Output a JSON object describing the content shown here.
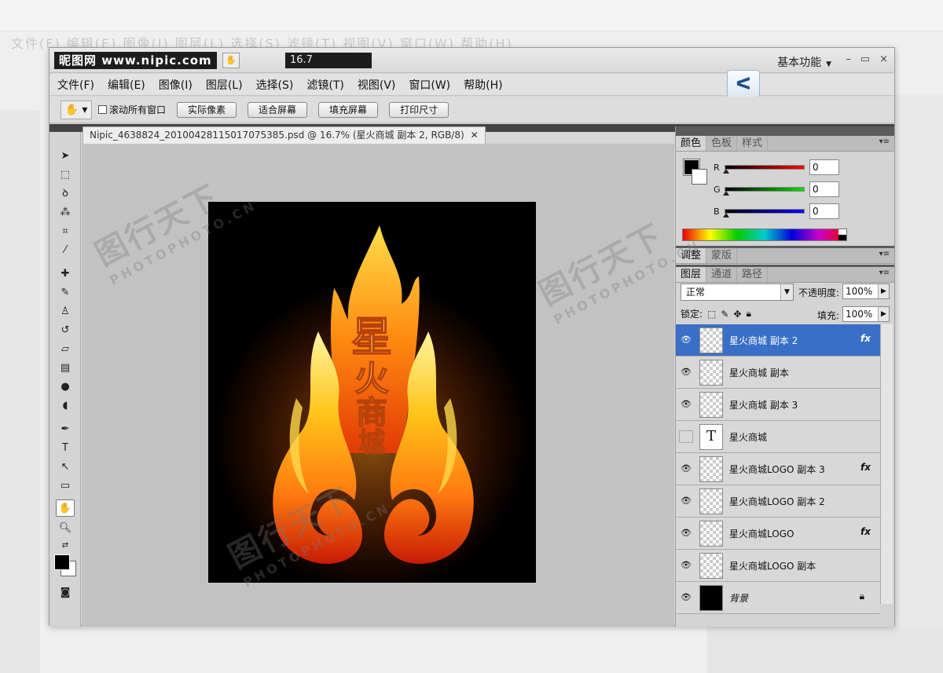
{
  "ghost_background": {
    "menu_text": "文件(F)  编辑(E)  图像(I)  图层(L)  选择(S)  滤镜(T)  视图(V)  窗口(W)  帮助(H)",
    "workspace_label": "基本功能"
  },
  "window": {
    "logo_text": "昵图网 www.nipic.com",
    "zoom_display": "16.7",
    "workspace_label": "基本功能",
    "controls": [
      "–",
      "▭",
      "×"
    ]
  },
  "menu": [
    "文件(F)",
    "编辑(E)",
    "图像(I)",
    "图层(L)",
    "选择(S)",
    "滤镜(T)",
    "视图(V)",
    "窗口(W)",
    "帮助(H)"
  ],
  "options_bar": {
    "scroll_all_label": "滚动所有窗口",
    "buttons": [
      "实际像素",
      "适合屏幕",
      "填充屏幕",
      "打印尺寸"
    ]
  },
  "document": {
    "tab_title": "Nipic_4638824_20100428115017075385.psd @ 16.7% (星火商城 副本 2, RGB/8)",
    "artwork_text": "星火商城"
  },
  "color_panel": {
    "tabs": [
      "颜色",
      "色板",
      "样式"
    ],
    "r_label": "R",
    "g_label": "G",
    "b_label": "B",
    "r_value": "0",
    "g_value": "0",
    "b_value": "0",
    "fg_color": "#000000",
    "bg_color": "#ffffff"
  },
  "adjust_panel": {
    "tabs": [
      "调整",
      "蒙版"
    ]
  },
  "layers_panel": {
    "tabs": [
      "图层",
      "通道",
      "路径"
    ],
    "blend_mode": "正常",
    "opacity_label": "不透明度:",
    "opacity_value": "100%",
    "lock_label": "锁定:",
    "fill_label": "填充:",
    "fill_value": "100%",
    "layers": [
      {
        "name": "星火商城 副本 2",
        "visible": true,
        "fx": true,
        "selected": true
      },
      {
        "name": "星火商城 副本",
        "visible": true,
        "fx": false
      },
      {
        "name": "星火商城 副本 3",
        "visible": true,
        "fx": false
      },
      {
        "name": "星火商城",
        "visible": false,
        "fx": false,
        "type": "text"
      },
      {
        "name": "星火商城LOGO 副本 3",
        "visible": true,
        "fx": true
      },
      {
        "name": "星火商城LOGO 副本 2",
        "visible": true,
        "fx": false
      },
      {
        "name": "星火商城LOGO",
        "visible": true,
        "fx": true
      },
      {
        "name": "星火商城LOGO 副本",
        "visible": true,
        "fx": false
      },
      {
        "name": "背景",
        "visible": true,
        "fx": false,
        "locked": true
      }
    ],
    "fx_label": "fx",
    "text_thumb": "T"
  },
  "watermark": {
    "main": "图行天下",
    "sub": "PHOTOPHOTO.CN"
  }
}
